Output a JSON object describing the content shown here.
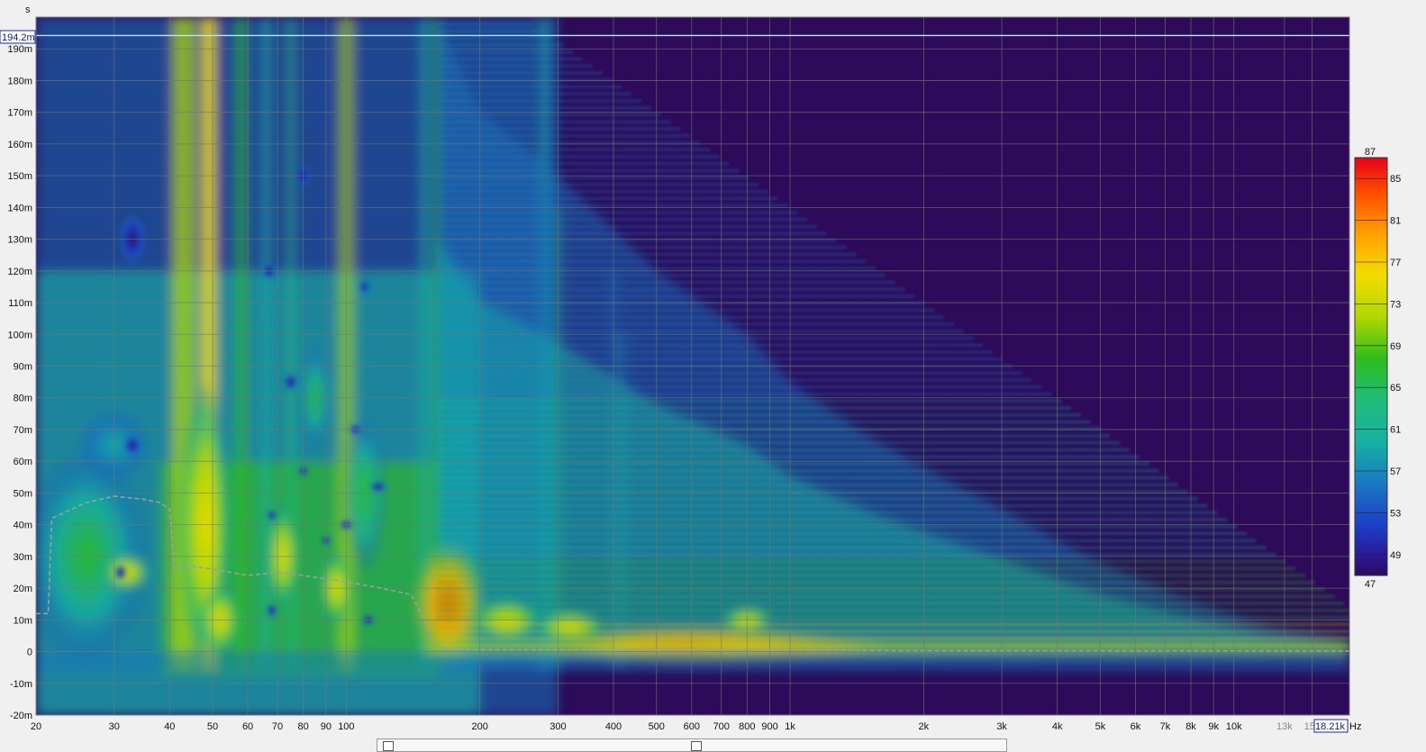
{
  "chart_data": {
    "type": "heatmap",
    "title": "",
    "xlabel": "Hz",
    "ylabel": "s",
    "x_scale": "log",
    "xlim": [
      20,
      18210
    ],
    "ylim": [
      -0.02,
      0.2
    ],
    "x_ticks": [
      {
        "v": 20,
        "label": "20"
      },
      {
        "v": 30,
        "label": "30"
      },
      {
        "v": 40,
        "label": "40"
      },
      {
        "v": 50,
        "label": "50"
      },
      {
        "v": 60,
        "label": "60"
      },
      {
        "v": 70,
        "label": "70"
      },
      {
        "v": 80,
        "label": "80"
      },
      {
        "v": 90,
        "label": "90"
      },
      {
        "v": 100,
        "label": "100"
      },
      {
        "v": 200,
        "label": "200"
      },
      {
        "v": 300,
        "label": "300"
      },
      {
        "v": 400,
        "label": "400"
      },
      {
        "v": 500,
        "label": "500"
      },
      {
        "v": 600,
        "label": "600"
      },
      {
        "v": 700,
        "label": "700"
      },
      {
        "v": 800,
        "label": "800"
      },
      {
        "v": 900,
        "label": "900"
      },
      {
        "v": 1000,
        "label": "1k"
      },
      {
        "v": 2000,
        "label": "2k"
      },
      {
        "v": 3000,
        "label": "3k"
      },
      {
        "v": 4000,
        "label": "4k"
      },
      {
        "v": 5000,
        "label": "5k"
      },
      {
        "v": 6000,
        "label": "6k"
      },
      {
        "v": 7000,
        "label": "7k"
      },
      {
        "v": 8000,
        "label": "8k"
      },
      {
        "v": 9000,
        "label": "9k"
      },
      {
        "v": 10000,
        "label": "10k"
      },
      {
        "v": 13000,
        "label": "13k",
        "muted": true
      },
      {
        "v": 15000,
        "label": "15k",
        "muted": true
      }
    ],
    "y_ticks": [
      {
        "v": 0.19,
        "label": "190m"
      },
      {
        "v": 0.18,
        "label": "180m"
      },
      {
        "v": 0.17,
        "label": "170m"
      },
      {
        "v": 0.16,
        "label": "160m"
      },
      {
        "v": 0.15,
        "label": "150m"
      },
      {
        "v": 0.14,
        "label": "140m"
      },
      {
        "v": 0.13,
        "label": "130m"
      },
      {
        "v": 0.12,
        "label": "120m"
      },
      {
        "v": 0.11,
        "label": "110m"
      },
      {
        "v": 0.1,
        "label": "100m"
      },
      {
        "v": 0.09,
        "label": "90m"
      },
      {
        "v": 0.08,
        "label": "80m"
      },
      {
        "v": 0.07,
        "label": "70m"
      },
      {
        "v": 0.06,
        "label": "60m"
      },
      {
        "v": 0.05,
        "label": "50m"
      },
      {
        "v": 0.04,
        "label": "40m"
      },
      {
        "v": 0.03,
        "label": "30m"
      },
      {
        "v": 0.02,
        "label": "20m"
      },
      {
        "v": 0.01,
        "label": "10m"
      },
      {
        "v": 0.0,
        "label": "0"
      },
      {
        "v": -0.01,
        "label": "-10m"
      },
      {
        "v": -0.02,
        "label": "-20m"
      }
    ],
    "cursor": {
      "freq_label": "18.21k",
      "time_label": "194.2m",
      "freq": 18210,
      "time": 0.1942
    },
    "colorbar": {
      "min": 47,
      "max": 87,
      "labels": [
        "87",
        "85",
        "81",
        "77",
        "73",
        "69",
        "65",
        "61",
        "57",
        "53",
        "49",
        "47"
      ],
      "values": [
        87,
        85,
        81,
        77,
        73,
        69,
        65,
        61,
        57,
        53,
        49,
        47
      ],
      "colors": {
        "87": "#e8001a",
        "84": "#ff4a00",
        "80": "#ff9e00",
        "76": "#f2dc00",
        "72": "#b4d800",
        "68": "#2ebd1c",
        "64": "#1fbc78",
        "60": "#17b1a4",
        "56": "#1a78c0",
        "52": "#1d3ec7",
        "48": "#2a1690",
        "47": "#2d0a5a"
      }
    },
    "background_color": "#2d0a5a",
    "decay_threshold_curve": {
      "color": "#9e9e9e",
      "points": [
        [
          20,
          0.012
        ],
        [
          21.3,
          0.012
        ],
        [
          21.7,
          0.042
        ],
        [
          26,
          0.047
        ],
        [
          30,
          0.049
        ],
        [
          35,
          0.048
        ],
        [
          38,
          0.047
        ],
        [
          40,
          0.045
        ],
        [
          41,
          0.026
        ],
        [
          45,
          0.027
        ],
        [
          50,
          0.026
        ],
        [
          60,
          0.024
        ],
        [
          70,
          0.025
        ],
        [
          80,
          0.024
        ],
        [
          100,
          0.022
        ],
        [
          120,
          0.02
        ],
        [
          140,
          0.018
        ],
        [
          150,
          0.01
        ],
        [
          155,
          0.004
        ],
        [
          165,
          0.001
        ],
        [
          200,
          0.0006
        ],
        [
          500,
          0.0005
        ],
        [
          2000,
          0.0003
        ],
        [
          18210,
          0.0002
        ]
      ]
    }
  }
}
